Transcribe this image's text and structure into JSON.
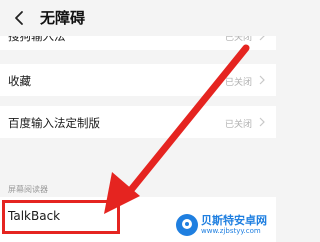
{
  "header": {
    "title": "无障碍",
    "back_icon": "back-arrow-icon"
  },
  "rows": [
    {
      "label": "搜狗输入法",
      "status": "已关闭"
    },
    {
      "label": "收藏",
      "status": "已关闭"
    },
    {
      "label": "百度输入法定制版",
      "status": "已关闭"
    }
  ],
  "section": {
    "label": "屏幕阅读器"
  },
  "talkback": {
    "label": "TalkBack"
  },
  "annotation": {
    "color": "#e52420"
  },
  "watermark": {
    "name": "贝斯特安卓网",
    "url": "www.zjbstyy.com"
  }
}
